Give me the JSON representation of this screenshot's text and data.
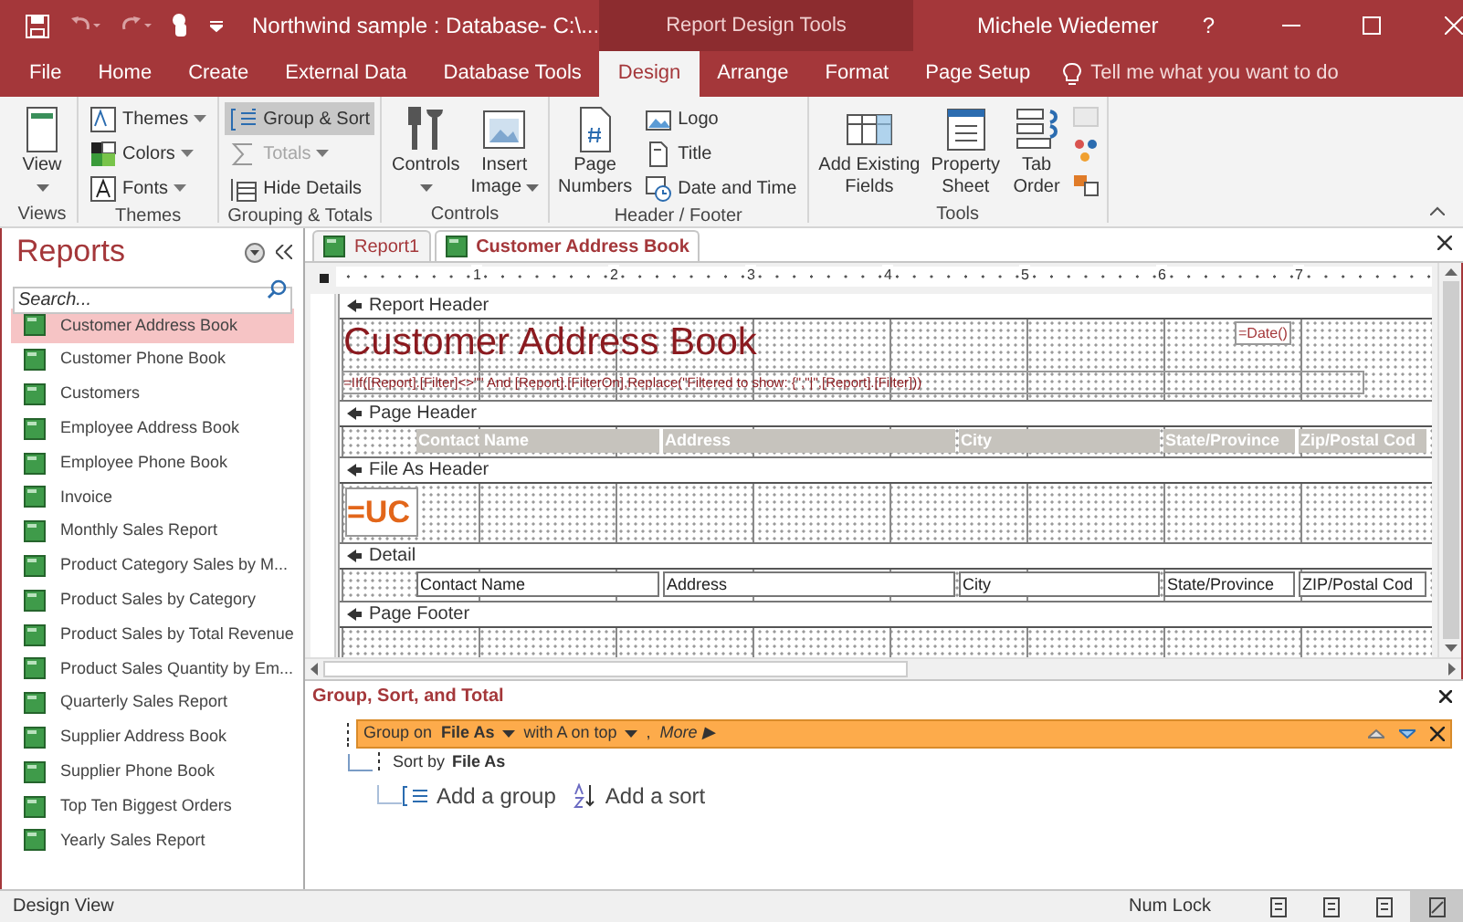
{
  "title_bar": {
    "document": "Northwind sample : Database- C:\\...",
    "context": "Report Design Tools",
    "user": "Michele Wiedemer",
    "help": "?"
  },
  "ribbon_tabs": [
    {
      "label": "File",
      "selected": false
    },
    {
      "label": "Home",
      "selected": false
    },
    {
      "label": "Create",
      "selected": false
    },
    {
      "label": "External Data",
      "selected": false
    },
    {
      "label": "Database Tools",
      "selected": false
    },
    {
      "label": "Design",
      "selected": true
    },
    {
      "label": "Arrange",
      "selected": false
    },
    {
      "label": "Format",
      "selected": false
    },
    {
      "label": "Page Setup",
      "selected": false
    }
  ],
  "tell_me": "Tell me what you want to do",
  "ribbon_groups": [
    {
      "label": "Views",
      "items": [
        {
          "kind": "large",
          "lines": [
            "View"
          ],
          "dropdown": true,
          "selected": false,
          "disabled": false
        }
      ]
    },
    {
      "label": "Themes",
      "items": [
        {
          "kind": "small",
          "lines": [
            "Themes"
          ],
          "dropdown": true,
          "selected": false,
          "disabled": false
        },
        {
          "kind": "small",
          "lines": [
            "Colors"
          ],
          "dropdown": true,
          "selected": false,
          "disabled": false
        },
        {
          "kind": "small",
          "lines": [
            "Fonts"
          ],
          "dropdown": true,
          "selected": false,
          "disabled": false
        }
      ]
    },
    {
      "label": "Grouping & Totals",
      "items": [
        {
          "kind": "small",
          "lines": [
            "Group & Sort"
          ],
          "dropdown": false,
          "selected": true,
          "disabled": false
        },
        {
          "kind": "small",
          "lines": [
            "Totals"
          ],
          "dropdown": true,
          "selected": false,
          "disabled": true
        },
        {
          "kind": "small",
          "lines": [
            "Hide Details"
          ],
          "dropdown": false,
          "selected": false,
          "disabled": false
        }
      ]
    },
    {
      "label": "Controls",
      "items": [
        {
          "kind": "large",
          "lines": [
            "Controls"
          ],
          "dropdown": true,
          "selected": false,
          "disabled": false
        },
        {
          "kind": "large",
          "lines": [
            "Insert",
            "Image"
          ],
          "dropdown": true,
          "selected": false,
          "disabled": false
        }
      ]
    },
    {
      "label": "Header / Footer",
      "items": [
        {
          "kind": "large",
          "lines": [
            "Page",
            "Numbers"
          ],
          "dropdown": false,
          "selected": false,
          "disabled": false
        },
        {
          "kind": "small",
          "lines": [
            "Logo"
          ],
          "dropdown": false,
          "selected": false,
          "disabled": false
        },
        {
          "kind": "small",
          "lines": [
            "Title"
          ],
          "dropdown": false,
          "selected": false,
          "disabled": false
        },
        {
          "kind": "small",
          "lines": [
            "Date and Time"
          ],
          "dropdown": false,
          "selected": false,
          "disabled": false
        }
      ]
    },
    {
      "label": "Tools",
      "items": [
        {
          "kind": "large",
          "lines": [
            "Add Existing",
            "Fields"
          ],
          "dropdown": false,
          "selected": false,
          "disabled": false
        },
        {
          "kind": "large",
          "lines": [
            "Property",
            "Sheet"
          ],
          "dropdown": false,
          "selected": false,
          "disabled": false
        },
        {
          "kind": "large",
          "lines": [
            "Tab",
            "Order"
          ],
          "dropdown": false,
          "selected": false,
          "disabled": false
        },
        {
          "kind": "icon",
          "selected": false,
          "disabled": true
        },
        {
          "kind": "icon",
          "selected": false,
          "disabled": false
        },
        {
          "kind": "icon",
          "selected": false,
          "disabled": false
        }
      ]
    }
  ],
  "nav": {
    "title": "Reports",
    "search": {
      "placeholder": "Search..."
    },
    "items": [
      {
        "label": "Customer Address Book",
        "selected": true
      },
      {
        "label": "Customer Phone Book",
        "selected": false
      },
      {
        "label": "Customers",
        "selected": false
      },
      {
        "label": "Employee Address Book",
        "selected": false
      },
      {
        "label": "Employee Phone Book",
        "selected": false
      },
      {
        "label": "Invoice",
        "selected": false
      },
      {
        "label": "Monthly Sales Report",
        "selected": false
      },
      {
        "label": "Product Category Sales by M...",
        "selected": false
      },
      {
        "label": "Product Sales by Category",
        "selected": false
      },
      {
        "label": "Product Sales by Total Revenue",
        "selected": false
      },
      {
        "label": "Product Sales Quantity by Em...",
        "selected": false
      },
      {
        "label": "Quarterly Sales Report",
        "selected": false
      },
      {
        "label": "Supplier Address Book",
        "selected": false
      },
      {
        "label": "Supplier Phone Book",
        "selected": false
      },
      {
        "label": "Top Ten Biggest Orders",
        "selected": false
      },
      {
        "label": "Yearly Sales Report",
        "selected": false
      }
    ]
  },
  "document_tabs": [
    {
      "label": "Report1",
      "selected": false
    },
    {
      "label": "Customer Address Book",
      "selected": true
    }
  ],
  "ruler": [
    "1",
    "2",
    "3",
    "4",
    "5",
    "6",
    "7"
  ],
  "sections": [
    {
      "kind": "report_header",
      "name": "Report Header",
      "title": "Customer Address Book",
      "date": "=Date()",
      "filter": "=IIf([Report].[Filter]<>\"\" And [Report].[FilterOn],Replace(\"Filtered to show: {\",\"|\",[Report].[Filter]))"
    },
    {
      "kind": "page_header",
      "name": "Page Header",
      "labels": [
        "Contact Name",
        "Address",
        "City",
        "State/Province",
        "Zip/Postal Cod"
      ]
    },
    {
      "kind": "group_header",
      "name": "File As Header",
      "expression": "=UC"
    },
    {
      "kind": "detail",
      "name": "Detail",
      "fields": [
        "Contact Name",
        "Address",
        "City",
        "State/Province",
        "ZIP/Postal Cod"
      ]
    },
    {
      "kind": "page_footer",
      "name": "Page Footer"
    }
  ],
  "group_pane": {
    "title": "Group, Sort, and Total",
    "group": {
      "prefix": "Group on",
      "field": "File As",
      "order": "with A on top",
      "comma": ",",
      "more": "More ▶"
    },
    "sort": {
      "prefix": "Sort by",
      "field": "File As"
    },
    "add_group": "Add a group",
    "add_sort": "Add a sort"
  },
  "status_bar": {
    "view": "Design View",
    "num_lock": "Num Lock",
    "views": [
      {
        "selected": false
      },
      {
        "selected": false
      },
      {
        "selected": false
      },
      {
        "selected": true
      }
    ]
  }
}
